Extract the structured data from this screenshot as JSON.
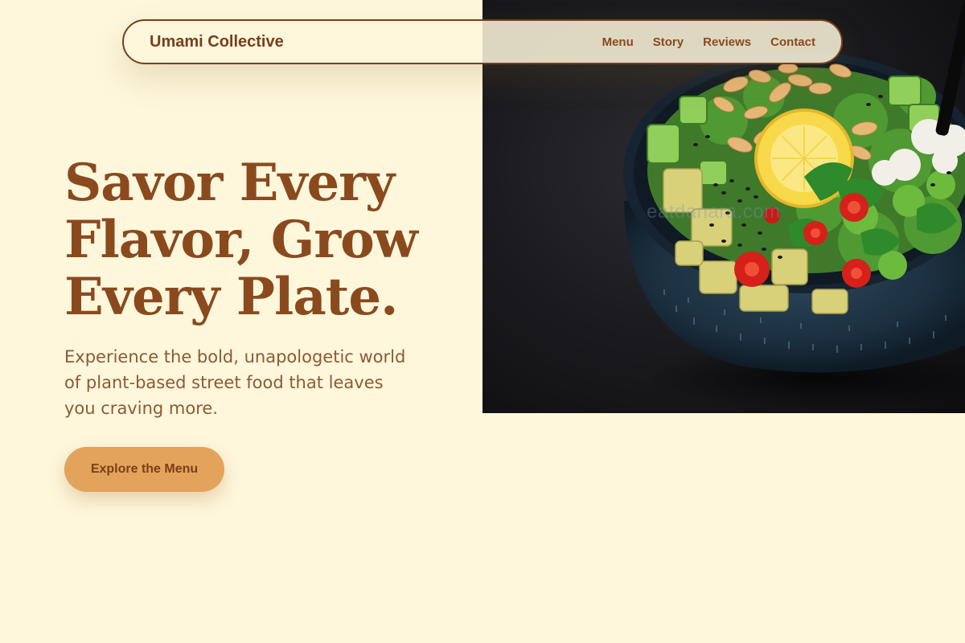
{
  "nav": {
    "brand": "Umami Collective",
    "links": [
      {
        "label": "Menu"
      },
      {
        "label": "Story"
      },
      {
        "label": "Reviews"
      },
      {
        "label": "Contact"
      }
    ]
  },
  "hero": {
    "headline_lines": [
      "Savor Every",
      "Flavor, Grow",
      "Every Plate."
    ],
    "subtext": "Experience the bold, unapologetic world of plant-based street food that leaves you craving more.",
    "cta_label": "Explore the Menu",
    "image": {
      "subject": "plant-based salad bowl",
      "watermark": "eatdanara.com"
    }
  },
  "colors": {
    "background": "#fef7dc",
    "primary_brown": "#8a4a1e",
    "accent": "#e3a35a"
  }
}
